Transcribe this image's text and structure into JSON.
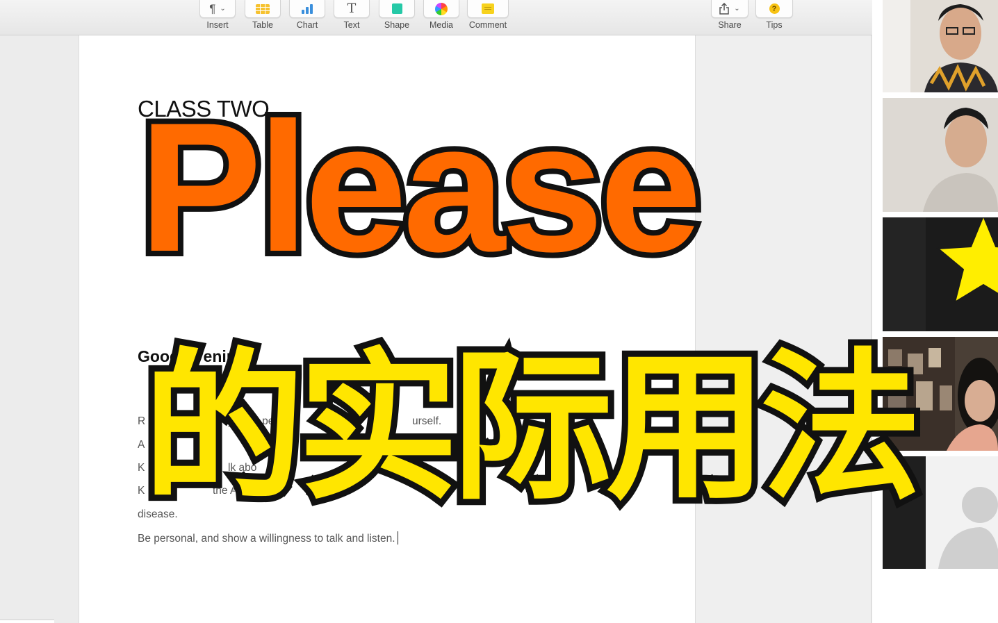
{
  "toolbar": {
    "items": [
      {
        "label": "Insert",
        "icon": "paragraph-icon"
      },
      {
        "label": "Table",
        "icon": "table-icon"
      },
      {
        "label": "Chart",
        "icon": "chart-icon"
      },
      {
        "label": "Text",
        "icon": "text-icon"
      },
      {
        "label": "Shape",
        "icon": "shape-icon"
      },
      {
        "label": "Media",
        "icon": "media-icon"
      },
      {
        "label": "Comment",
        "icon": "comment-icon"
      }
    ],
    "share_label": "Share",
    "tips_label": "Tips",
    "paragraph_glyph": "¶",
    "text_glyph": "T",
    "tips_glyph": "?"
  },
  "document": {
    "title": "CLASS TWO",
    "greeting": "Good Evening!",
    "fragments": {
      "line1_start": "R",
      "line1_mid": "y — ... peop",
      "line1_end": "urself.",
      "line2_start": "A",
      "line3_start": "K",
      "line3_mid": "lk abo",
      "line4_start": "K",
      "line4_mid": "the Au",
      "line5": "disease."
    },
    "last_line": "Be personal, and show a willingness to talk and listen."
  },
  "overlay": {
    "english": "Please",
    "chinese": "的实际用法"
  },
  "colors": {
    "overlay_english": "#ff6a00",
    "overlay_chinese": "#ffe600",
    "overlay_stroke": "#111111",
    "star": "#ffee00"
  },
  "participants": [
    {
      "name": "participant-1",
      "type": "video"
    },
    {
      "name": "participant-2",
      "type": "video"
    },
    {
      "name": "participant-3",
      "type": "star-avatar"
    },
    {
      "name": "participant-4",
      "type": "video"
    },
    {
      "name": "participant-5",
      "type": "default-avatar"
    }
  ]
}
